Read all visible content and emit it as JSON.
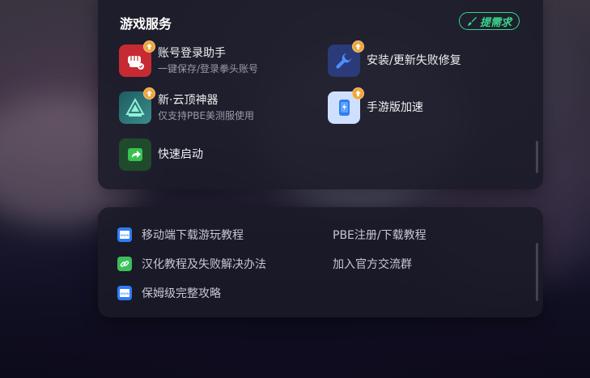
{
  "services_panel": {
    "title": "游戏服务",
    "request_button": "提需求",
    "items": [
      {
        "name": "账号登录助手",
        "subtitle": "一键保存/登录拳头账号",
        "icon": "fist-icon",
        "badge": "update-arrow-icon"
      },
      {
        "name": "安装/更新失败修复",
        "subtitle": "",
        "icon": "wrench-icon",
        "badge": "update-arrow-icon"
      },
      {
        "name": "新·云顶神器",
        "subtitle": "仅支持PBE美测服使用",
        "icon": "tft-icon",
        "badge": "update-arrow-icon"
      },
      {
        "name": "手游版加速",
        "subtitle": "",
        "icon": "phone-icon",
        "badge": "update-arrow-icon"
      },
      {
        "name": "快速启动",
        "subtitle": "",
        "icon": "launch-icon",
        "badge": ""
      }
    ]
  },
  "links_panel": {
    "items": [
      {
        "label": "移动端下载游玩教程",
        "icon": "web-icon"
      },
      {
        "label": "PBE注册/下载教程",
        "icon": ""
      },
      {
        "label": "汉化教程及失败解决办法",
        "icon": "link-icon"
      },
      {
        "label": "加入官方交流群",
        "icon": ""
      },
      {
        "label": "保姆级完整攻略",
        "icon": "web-icon"
      }
    ]
  },
  "colors": {
    "accent_green": "#39d68e",
    "badge_orange": "#f0a53a",
    "panel_bg": "#1a1a28"
  }
}
